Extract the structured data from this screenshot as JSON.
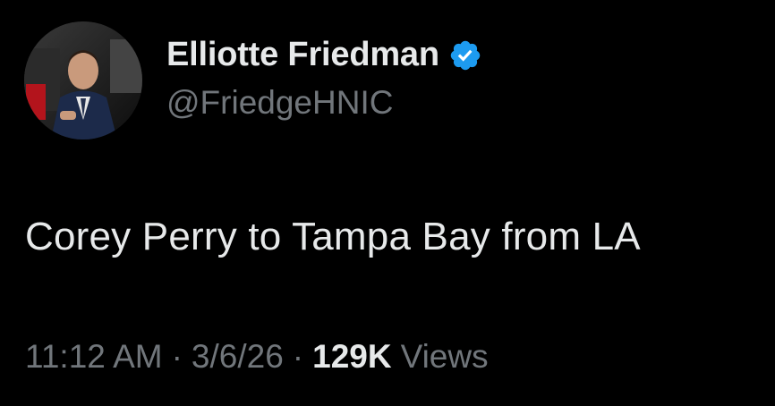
{
  "author": {
    "display_name": "Elliotte Friedman",
    "handle": "@FriedgeHNIC",
    "verified_icon": "verified-badge-icon",
    "avatar_icon": "profile-photo"
  },
  "tweet": {
    "text": "Corey Perry to Tampa Bay from LA"
  },
  "meta": {
    "time": "11:12 AM",
    "separator": "·",
    "date": "3/6/26",
    "views_count": "129K",
    "views_label": "Views"
  },
  "colors": {
    "background": "#000000",
    "primary_text": "#e7e9ea",
    "secondary_text": "#71767b",
    "verified_blue": "#1d9bf0"
  }
}
